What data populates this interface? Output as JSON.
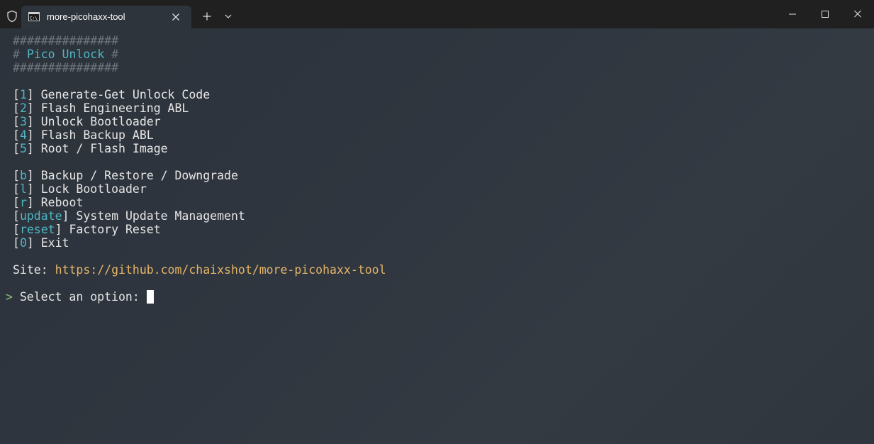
{
  "titlebar": {
    "tab_title": "more-picohaxx-tool"
  },
  "header": {
    "border_top": "###############",
    "hash_left": "#",
    "title": "Pico Unlock",
    "hash_right": "#",
    "border_bottom": "###############"
  },
  "menu": {
    "group1": [
      {
        "key": "1",
        "label": "Generate-Get Unlock Code"
      },
      {
        "key": "2",
        "label": "Flash Engineering ABL"
      },
      {
        "key": "3",
        "label": "Unlock Bootloader"
      },
      {
        "key": "4",
        "label": "Flash Backup ABL"
      },
      {
        "key": "5",
        "label": "Root / Flash Image"
      }
    ],
    "group2": [
      {
        "key": "b",
        "label": "Backup / Restore / Downgrade"
      },
      {
        "key": "l",
        "label": "Lock Bootloader"
      },
      {
        "key": "r",
        "label": "Reboot"
      },
      {
        "key": "update",
        "label": "System Update Management"
      },
      {
        "key": "reset",
        "label": "Factory Reset"
      },
      {
        "key": "0",
        "label": "Exit"
      }
    ]
  },
  "site": {
    "label": "Site:",
    "url": "https://github.com/chaixshot/more-picohaxx-tool"
  },
  "prompt": {
    "symbol": ">",
    "text": "Select an option:"
  },
  "colors": {
    "accent_cyan": "#4fb6c4",
    "url_yellow": "#e5b567",
    "prompt_green": "#8ec07c",
    "dim_gray": "#6d747c"
  },
  "icons": {
    "shield": "shield-icon",
    "tab": "terminal-icon",
    "close": "close-icon",
    "new_tab": "plus-icon",
    "dropdown": "chevron-down-icon",
    "minimize": "minimize-icon",
    "maximize": "maximize-icon",
    "window_close": "window-close-icon"
  }
}
